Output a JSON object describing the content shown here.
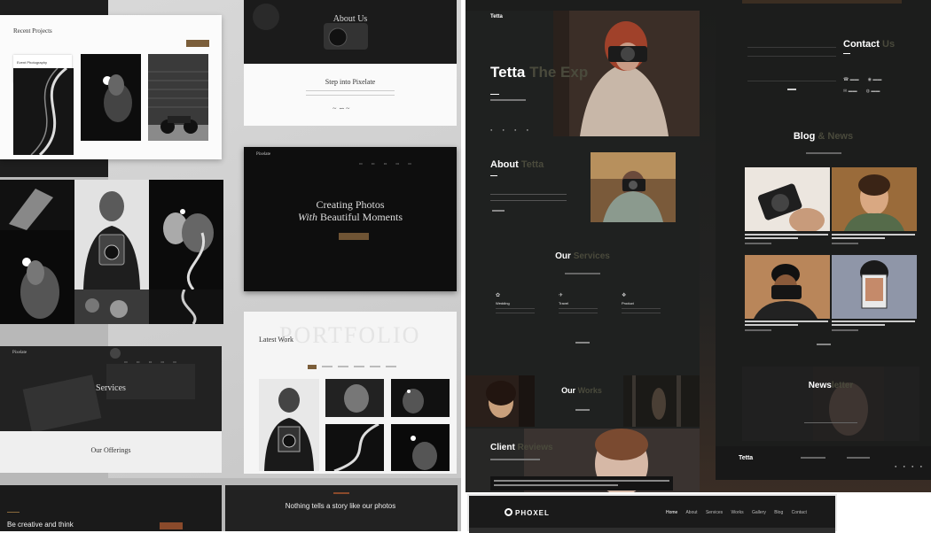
{
  "colors": {
    "accent": "#8a6a3b",
    "dark": "#141414",
    "panel": "#1d1f1e",
    "light": "#f4f4f4",
    "gold": "#7b5e3a"
  },
  "left": {
    "recent": {
      "title": "Recent Projects",
      "tag": "Event Photography",
      "button": ""
    },
    "about": {
      "title": "About Us",
      "step": "Step into Pixelate"
    },
    "hero": {
      "brand": "Pixelate",
      "line1": "Creating Photos",
      "line2": "With",
      "line3": "Beautiful Moments"
    },
    "services": {
      "brand": "Pixelate",
      "title": "Services",
      "offer": "Our Offerings"
    },
    "latest": {
      "title": "Latest Work",
      "bg": "PORTFOLIO"
    },
    "bottom": {
      "think": "Be creative and think",
      "story": "Nothing tells a story like our photos"
    }
  },
  "right": {
    "brand": "Tetta",
    "hero_a": "Tetta",
    "hero_b": "The Exp",
    "about_a": "About",
    "about_b": "Tetta",
    "services_a": "Our",
    "services_b": "Services",
    "services": [
      {
        "name": "Wedding"
      },
      {
        "name": "Travel"
      },
      {
        "name": "Product"
      }
    ],
    "works_a": "Our",
    "works_b": "Works",
    "client_a": "Client",
    "client_b": "Reviews",
    "contact_a": "Contact",
    "contact_b": "Us",
    "blog_a": "Blog",
    "blog_b": "& News",
    "news_a": "News",
    "news_b": "letter",
    "footer_brand": "Tetta",
    "phoxel": "PHOXEL",
    "phoxel_nav": [
      "Home",
      "About",
      "Services",
      "Works",
      "Gallery",
      "Blog",
      "Contact"
    ]
  }
}
